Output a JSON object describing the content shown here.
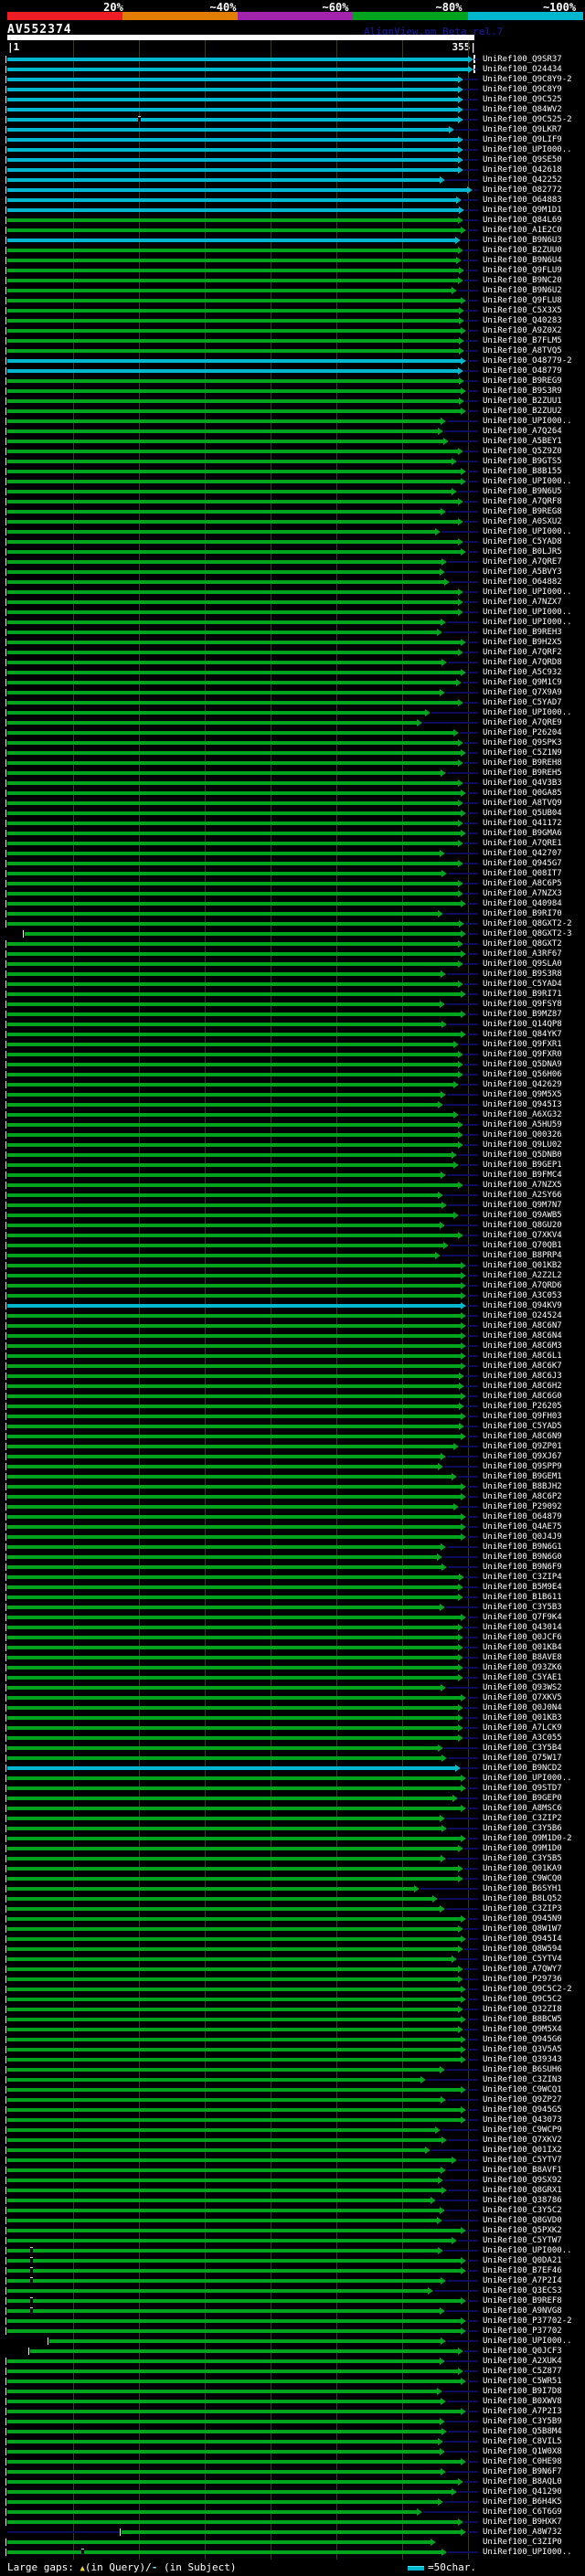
{
  "header": {
    "query_id": "AV552374",
    "watermark": "AlignView.pm Beta rel.7",
    "ruler_start_label": "|1",
    "ruler_end_label": "355|",
    "scale": [
      {
        "label": "20%",
        "color": "#ee1c25"
      },
      {
        "label": "~40%",
        "color": "#e17c05"
      },
      {
        "label": "~60%",
        "color": "#a224ad"
      },
      {
        "label": "~80%",
        "color": "#00a31e"
      },
      {
        "label": "~100%",
        "color": "#00b7cd"
      }
    ]
  },
  "legend": {
    "prefix": "Large gaps: ",
    "query_gap_symbol": "▲",
    "query_text": "(in Query)/",
    "subject_gap_symbol": "-",
    "subject_text": " (in Subject)",
    "swatch_label": "=50char."
  },
  "colors": {
    "background": "#000000",
    "bar_green": "#00a31e",
    "bar_cyan": "#00b7cd",
    "connector_navy": "#0c0c5a",
    "gridline_olive": "#3c3c10",
    "text_white": "#ffffff",
    "watermark_navy": "#14147a",
    "gap_yellow": "#e6d23c"
  },
  "chart_data": {
    "type": "alignment_overview",
    "title": "AV552374",
    "query_length": 355,
    "ruler_ticks": [
      1,
      355
    ],
    "gridline_residues": [
      51,
      101,
      151,
      201,
      251,
      301,
      351
    ],
    "gridline_spacing_chars": 50,
    "id_prefix": "UniRef100_",
    "rows": [
      {
        "id": "Q9SR37",
        "c": "cyan",
        "e": 351,
        "t": 1
      },
      {
        "id": "O24434",
        "c": "cyan",
        "e": 351,
        "t": 1
      },
      {
        "id": "Q9C8Y9-2",
        "c": "cyan",
        "e": 343
      },
      {
        "id": "Q9C8Y9",
        "c": "cyan",
        "e": 343
      },
      {
        "id": "Q9C525",
        "c": "cyan",
        "e": 343
      },
      {
        "id": "Q84WV2",
        "c": "cyan",
        "e": 343
      },
      {
        "id": "Q9C525-2",
        "c": "cyan",
        "e": 343,
        "n": 100
      },
      {
        "id": "Q9LKR7",
        "c": "cyan",
        "e": 336
      },
      {
        "id": "Q9LIF9",
        "c": "cyan",
        "e": 343
      },
      {
        "id": "UPI000..",
        "c": "cyan",
        "e": 343
      },
      {
        "id": "Q9SE50",
        "c": "cyan",
        "e": 343
      },
      {
        "id": "Q42618",
        "c": "cyan",
        "e": 343
      },
      {
        "id": "Q42252",
        "c": "cyan",
        "e": 329
      },
      {
        "id": "O82772",
        "c": "cyan",
        "e": 350
      },
      {
        "id": "O64883",
        "c": "cyan",
        "e": 342
      },
      {
        "id": "Q9M1D1",
        "c": "cyan",
        "e": 344
      },
      {
        "id": "Q84L69",
        "e": 343
      },
      {
        "id": "A1E2C0",
        "e": 345
      },
      {
        "id": "B9N6U3",
        "c": "cyan",
        "e": 341
      },
      {
        "id": "B2ZUU0",
        "e": 343
      },
      {
        "id": "B9N6U4",
        "e": 342
      },
      {
        "id": "Q9FLU9",
        "e": 344
      },
      {
        "id": "B9NC20",
        "e": 343
      },
      {
        "id": "B9N6U2",
        "e": 338
      },
      {
        "id": "Q9FLU8",
        "e": 345
      },
      {
        "id": "C5X3X5",
        "e": 344
      },
      {
        "id": "Q40283",
        "e": 344
      },
      {
        "id": "A9Z0X2",
        "e": 345
      },
      {
        "id": "B7FLM5",
        "e": 344
      },
      {
        "id": "A8TVQ5",
        "e": 344
      },
      {
        "id": "O48779-2",
        "c": "cyan",
        "e": 345
      },
      {
        "id": "O48779",
        "c": "cyan",
        "e": 343
      },
      {
        "id": "B9REG9",
        "e": 344
      },
      {
        "id": "B9S3R9",
        "e": 345
      },
      {
        "id": "B2ZUU1",
        "e": 344
      },
      {
        "id": "B2ZUU2",
        "e": 345
      },
      {
        "id": "UPI000..",
        "e": 330
      },
      {
        "id": "A7Q264",
        "e": 328
      },
      {
        "id": "A5BEY1",
        "e": 332
      },
      {
        "id": "Q5Z9Z0",
        "e": 343
      },
      {
        "id": "B9GTS5",
        "e": 338
      },
      {
        "id": "B8B155",
        "e": 345
      },
      {
        "id": "UPI000..",
        "e": 345
      },
      {
        "id": "B9N6U5",
        "e": 338
      },
      {
        "id": "A7QRF8",
        "e": 343
      },
      {
        "id": "B9REG8",
        "e": 330
      },
      {
        "id": "A0SXU2",
        "e": 343
      },
      {
        "id": "UPI000..",
        "e": 326
      },
      {
        "id": "C5YAD8",
        "e": 343
      },
      {
        "id": "B0LJR5",
        "e": 345
      },
      {
        "id": "A7QRE7",
        "e": 331
      },
      {
        "id": "A5BVY3",
        "e": 329
      },
      {
        "id": "O64882",
        "e": 333
      },
      {
        "id": "UPI000..",
        "e": 343
      },
      {
        "id": "A7NZX7",
        "e": 343
      },
      {
        "id": "UPI000..",
        "e": 343
      },
      {
        "id": "UPI000..",
        "e": 330
      },
      {
        "id": "B9REH3",
        "e": 327
      },
      {
        "id": "B9H2X5",
        "e": 345
      },
      {
        "id": "A7QRF2",
        "e": 343
      },
      {
        "id": "A7QRD8",
        "e": 331
      },
      {
        "id": "A5C932",
        "e": 345
      },
      {
        "id": "Q9M1C9",
        "e": 342
      },
      {
        "id": "Q7X9A9",
        "e": 329
      },
      {
        "id": "C5YAD7",
        "e": 343
      },
      {
        "id": "UPI000..",
        "e": 318
      },
      {
        "id": "A7QRE9",
        "e": 312
      },
      {
        "id": "P26204",
        "e": 340
      },
      {
        "id": "Q9SPK3",
        "e": 343
      },
      {
        "id": "C5Z1N9",
        "e": 345
      },
      {
        "id": "B9REH8",
        "e": 343
      },
      {
        "id": "B9REH5",
        "e": 330
      },
      {
        "id": "Q4V3B3",
        "e": 343
      },
      {
        "id": "Q0GA85",
        "e": 345
      },
      {
        "id": "A8TVQ9",
        "e": 343
      },
      {
        "id": "Q5UB04",
        "e": 345
      },
      {
        "id": "Q41172",
        "e": 343
      },
      {
        "id": "B9GMA6",
        "e": 345
      },
      {
        "id": "A7QRE1",
        "e": 343
      },
      {
        "id": "Q42707",
        "e": 329
      },
      {
        "id": "Q945G7",
        "e": 343
      },
      {
        "id": "Q08IT7",
        "e": 331
      },
      {
        "id": "A8C6P5",
        "e": 343
      },
      {
        "id": "A7NZX3",
        "e": 343
      },
      {
        "id": "Q40984",
        "e": 345
      },
      {
        "id": "B9RI70",
        "e": 328
      },
      {
        "id": "Q8GXT2-2",
        "e": 344
      },
      {
        "id": "Q8GXT2-3",
        "s": 14,
        "e": 345
      },
      {
        "id": "Q8GXT2",
        "e": 343
      },
      {
        "id": "A3RF67",
        "e": 345
      },
      {
        "id": "Q9SLA0",
        "e": 343
      },
      {
        "id": "B9S3R8",
        "e": 330
      },
      {
        "id": "C5YAD4",
        "e": 343
      },
      {
        "id": "B9RI71",
        "e": 345
      },
      {
        "id": "Q9FSY8",
        "e": 329
      },
      {
        "id": "B9MZ87",
        "e": 345
      },
      {
        "id": "Q14QP8",
        "e": 331
      },
      {
        "id": "Q84YK7",
        "e": 345
      },
      {
        "id": "Q9FXR1",
        "e": 340
      },
      {
        "id": "Q9FXR0",
        "e": 343
      },
      {
        "id": "Q5DNA9",
        "e": 343
      },
      {
        "id": "Q56H06",
        "e": 343
      },
      {
        "id": "Q42629",
        "e": 340
      },
      {
        "id": "Q9M5X5",
        "e": 330
      },
      {
        "id": "Q945I3",
        "e": 328
      },
      {
        "id": "A6XG32",
        "e": 340
      },
      {
        "id": "A5HU59",
        "e": 343
      },
      {
        "id": "Q00326",
        "e": 343
      },
      {
        "id": "Q9LU02",
        "e": 343
      },
      {
        "id": "Q5DNB0",
        "e": 338
      },
      {
        "id": "B9GEP1",
        "e": 340
      },
      {
        "id": "B9FMC4",
        "e": 330
      },
      {
        "id": "A7NZX5",
        "e": 343
      },
      {
        "id": "A2SY66",
        "e": 328
      },
      {
        "id": "Q9M7N7",
        "e": 331
      },
      {
        "id": "Q9AWB5",
        "e": 340
      },
      {
        "id": "Q8GU20",
        "e": 329
      },
      {
        "id": "Q7XKV4",
        "e": 343
      },
      {
        "id": "Q70QB1",
        "e": 332
      },
      {
        "id": "B8PRP4",
        "e": 326
      },
      {
        "id": "Q01KB2",
        "e": 345
      },
      {
        "id": "A2Z2L2",
        "e": 345
      },
      {
        "id": "A7QRD6",
        "e": 345
      },
      {
        "id": "A3C053",
        "e": 345
      },
      {
        "id": "Q94KV9",
        "c": "cyan",
        "e": 345
      },
      {
        "id": "O24524",
        "e": 345
      },
      {
        "id": "A8C6N7",
        "e": 345
      },
      {
        "id": "A8C6N4",
        "e": 345
      },
      {
        "id": "A8C6M3",
        "e": 345
      },
      {
        "id": "A8C6L1",
        "e": 345
      },
      {
        "id": "A8C6K7",
        "e": 345
      },
      {
        "id": "A8C6J3",
        "e": 344
      },
      {
        "id": "A8C6H2",
        "e": 344
      },
      {
        "id": "A8C6G0",
        "e": 345
      },
      {
        "id": "P26205",
        "e": 344
      },
      {
        "id": "Q9FH03",
        "e": 345
      },
      {
        "id": "C5YAD5",
        "e": 344
      },
      {
        "id": "A8C6N9",
        "e": 345
      },
      {
        "id": "Q9ZP01",
        "e": 340
      },
      {
        "id": "Q9XJ67",
        "e": 330
      },
      {
        "id": "Q9SPP9",
        "e": 328
      },
      {
        "id": "B9GEM1",
        "e": 338
      },
      {
        "id": "B8BJH2",
        "e": 345
      },
      {
        "id": "A8C6P2",
        "e": 345
      },
      {
        "id": "P29092",
        "e": 340
      },
      {
        "id": "O64879",
        "e": 345
      },
      {
        "id": "Q4AE75",
        "e": 345
      },
      {
        "id": "Q0J4J9",
        "e": 345
      },
      {
        "id": "B9N6G1",
        "e": 330
      },
      {
        "id": "B9N6G0",
        "e": 327
      },
      {
        "id": "B9N6F9",
        "e": 331
      },
      {
        "id": "C3ZIP4",
        "e": 344
      },
      {
        "id": "B5M9E4",
        "e": 343
      },
      {
        "id": "B1B611",
        "e": 343
      },
      {
        "id": "C3Y5B3",
        "e": 329
      },
      {
        "id": "Q7F9K4",
        "e": 345
      },
      {
        "id": "Q43014",
        "e": 343
      },
      {
        "id": "Q0JCF6",
        "e": 343
      },
      {
        "id": "Q01KB4",
        "e": 343
      },
      {
        "id": "B8AVE8",
        "e": 343
      },
      {
        "id": "Q93ZK6",
        "e": 343
      },
      {
        "id": "C5YAE1",
        "e": 343
      },
      {
        "id": "Q93WS2",
        "e": 330
      },
      {
        "id": "Q7XKV5",
        "e": 345
      },
      {
        "id": "Q0J0N4",
        "e": 343
      },
      {
        "id": "Q01KB3",
        "e": 343
      },
      {
        "id": "A7LCK9",
        "e": 343
      },
      {
        "id": "A3C055",
        "e": 343
      },
      {
        "id": "C3Y5B4",
        "e": 328
      },
      {
        "id": "Q75W17",
        "e": 331
      },
      {
        "id": "B9NCD2",
        "c": "cyan",
        "e": 341
      },
      {
        "id": "UPI000..",
        "e": 345
      },
      {
        "id": "Q9STD7",
        "e": 345
      },
      {
        "id": "B9GEP0",
        "e": 339
      },
      {
        "id": "A8MSC6",
        "e": 345
      },
      {
        "id": "C3ZIP2",
        "e": 329
      },
      {
        "id": "C3Y5B6",
        "e": 331
      },
      {
        "id": "Q9M1D0-2",
        "e": 345
      },
      {
        "id": "Q9M1D0",
        "e": 343
      },
      {
        "id": "C3Y5B5",
        "e": 330
      },
      {
        "id": "Q01KA9",
        "e": 343
      },
      {
        "id": "C9WCQ0",
        "e": 343
      },
      {
        "id": "B6SYH1",
        "e": 310
      },
      {
        "id": "B8LQ52",
        "e": 324
      },
      {
        "id": "C3ZIP3",
        "e": 329
      },
      {
        "id": "Q945N9",
        "e": 345
      },
      {
        "id": "Q8W1W7",
        "e": 343
      },
      {
        "id": "Q945I4",
        "e": 345
      },
      {
        "id": "Q8W594",
        "e": 343
      },
      {
        "id": "C5YTV4",
        "e": 338
      },
      {
        "id": "A7QWY7",
        "e": 343
      },
      {
        "id": "P29736",
        "e": 343
      },
      {
        "id": "Q9C5C2-2",
        "e": 345
      },
      {
        "id": "Q9C5C2",
        "e": 345
      },
      {
        "id": "Q32ZI8",
        "e": 343
      },
      {
        "id": "B8BCW5",
        "e": 345
      },
      {
        "id": "Q9M5X4",
        "e": 343
      },
      {
        "id": "Q945G6",
        "e": 345
      },
      {
        "id": "Q3V5A5",
        "e": 345
      },
      {
        "id": "Q39343",
        "e": 345
      },
      {
        "id": "B6SUH6",
        "e": 329
      },
      {
        "id": "C3ZIN3",
        "e": 315
      },
      {
        "id": "C9WCQ1",
        "e": 345
      },
      {
        "id": "Q9ZP27",
        "e": 330
      },
      {
        "id": "Q945G5",
        "e": 345
      },
      {
        "id": "Q43073",
        "e": 345
      },
      {
        "id": "C9WCP9",
        "e": 326
      },
      {
        "id": "Q7XKV2",
        "e": 331
      },
      {
        "id": "Q01IX2",
        "e": 318
      },
      {
        "id": "C5YTV7",
        "e": 338
      },
      {
        "id": "B8AVF1",
        "e": 330
      },
      {
        "id": "Q9SX92",
        "e": 328
      },
      {
        "id": "Q8GRX1",
        "e": 331
      },
      {
        "id": "Q38786",
        "e": 322
      },
      {
        "id": "C3Y5C2",
        "e": 329
      },
      {
        "id": "Q8GVD0",
        "e": 327
      },
      {
        "id": "Q5PXK2",
        "e": 345
      },
      {
        "id": "C5YTW7",
        "e": 338
      },
      {
        "id": "UPI000..",
        "e": 328,
        "n": 18
      },
      {
        "id": "Q0DA21",
        "e": 345,
        "n": 18
      },
      {
        "id": "B7EF46",
        "e": 345,
        "n": 18
      },
      {
        "id": "A7P2I4",
        "e": 330,
        "n": 18
      },
      {
        "id": "Q3ECS3",
        "e": 320
      },
      {
        "id": "B9REF8",
        "e": 345,
        "n": 18
      },
      {
        "id": "A9NVG8",
        "e": 329,
        "n": 18
      },
      {
        "id": "P37702-2",
        "e": 345
      },
      {
        "id": "P37702",
        "e": 345
      },
      {
        "id": "UPI000..",
        "s": 33,
        "e": 330
      },
      {
        "id": "Q0JCF3",
        "s": 18,
        "e": 343
      },
      {
        "id": "A2XUK4",
        "e": 329
      },
      {
        "id": "C5Z877",
        "e": 343
      },
      {
        "id": "C5WR51",
        "e": 345
      },
      {
        "id": "B9I7D8",
        "e": 327
      },
      {
        "id": "B0XWV8",
        "e": 330
      },
      {
        "id": "A7P2I3",
        "e": 345
      },
      {
        "id": "C3Y5B9",
        "e": 329
      },
      {
        "id": "Q5B8M4",
        "e": 331
      },
      {
        "id": "C8VIL5",
        "e": 328
      },
      {
        "id": "Q1W0X8",
        "e": 329
      },
      {
        "id": "C0HE98",
        "e": 345
      },
      {
        "id": "B9N6F7",
        "e": 330
      },
      {
        "id": "B8AQL0",
        "e": 343
      },
      {
        "id": "Q41290",
        "e": 338
      },
      {
        "id": "B6H4K5",
        "e": 328
      },
      {
        "id": "C6T6G9",
        "e": 312
      },
      {
        "id": "B9HXK7",
        "e": 343
      },
      {
        "id": "A8W732",
        "s": 88,
        "e": 345,
        "ld": 1
      },
      {
        "id": "C3ZIP0",
        "e": 322,
        "x": 1
      },
      {
        "id": "UPI000..",
        "e": 331,
        "n": 57
      }
    ]
  }
}
